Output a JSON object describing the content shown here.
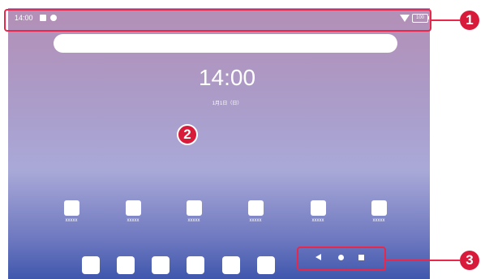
{
  "status_bar": {
    "time": "14:00",
    "battery": "100"
  },
  "home": {
    "clock": "14:00",
    "date": "1月1日（日）"
  },
  "apps": [
    {
      "label": "xxxxx"
    },
    {
      "label": "xxxxx"
    },
    {
      "label": "xxxxx"
    },
    {
      "label": "xxxxx"
    },
    {
      "label": "xxxxx"
    },
    {
      "label": "xxxxx"
    }
  ],
  "callouts": [
    "1",
    "2",
    "3"
  ],
  "colors": {
    "callout": "#d81b3a",
    "screen_top": "#b38fb6",
    "screen_bottom": "#3f57ad"
  }
}
